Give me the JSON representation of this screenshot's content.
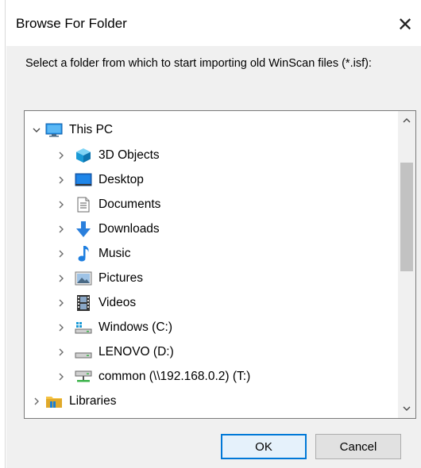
{
  "dialog": {
    "title": "Browse For Folder",
    "close_glyph": "✕",
    "instruction": "Select a folder from which to start importing old WinScan files (*.isf):"
  },
  "tree": {
    "items": [
      {
        "label": "This PC",
        "expanded": true,
        "icon": "monitor-icon",
        "level": 0
      },
      {
        "label": "3D Objects",
        "expanded": false,
        "icon": "cube-3d-icon",
        "level": 1
      },
      {
        "label": "Desktop",
        "expanded": false,
        "icon": "desktop-icon",
        "level": 1
      },
      {
        "label": "Documents",
        "expanded": false,
        "icon": "documents-icon",
        "level": 1
      },
      {
        "label": "Downloads",
        "expanded": false,
        "icon": "download-arrow-icon",
        "level": 1
      },
      {
        "label": "Music",
        "expanded": false,
        "icon": "music-note-icon",
        "level": 1
      },
      {
        "label": "Pictures",
        "expanded": false,
        "icon": "pictures-icon",
        "level": 1
      },
      {
        "label": "Videos",
        "expanded": false,
        "icon": "film-strip-icon",
        "level": 1
      },
      {
        "label": "Windows (C:)",
        "expanded": false,
        "icon": "windows-drive-icon",
        "level": 1
      },
      {
        "label": "LENOVO (D:)",
        "expanded": false,
        "icon": "drive-icon",
        "level": 1
      },
      {
        "label": "common (\\\\192.168.0.2) (T:)",
        "expanded": false,
        "icon": "network-drive-icon",
        "level": 1
      },
      {
        "label": "Libraries",
        "expanded": false,
        "icon": "libraries-folder-icon",
        "level": 0
      }
    ]
  },
  "buttons": {
    "ok": "OK",
    "cancel": "Cancel"
  },
  "colors": {
    "accent": "#0078d7",
    "dialog_bg": "#f0f0f0",
    "tree_bg": "#ffffff"
  }
}
